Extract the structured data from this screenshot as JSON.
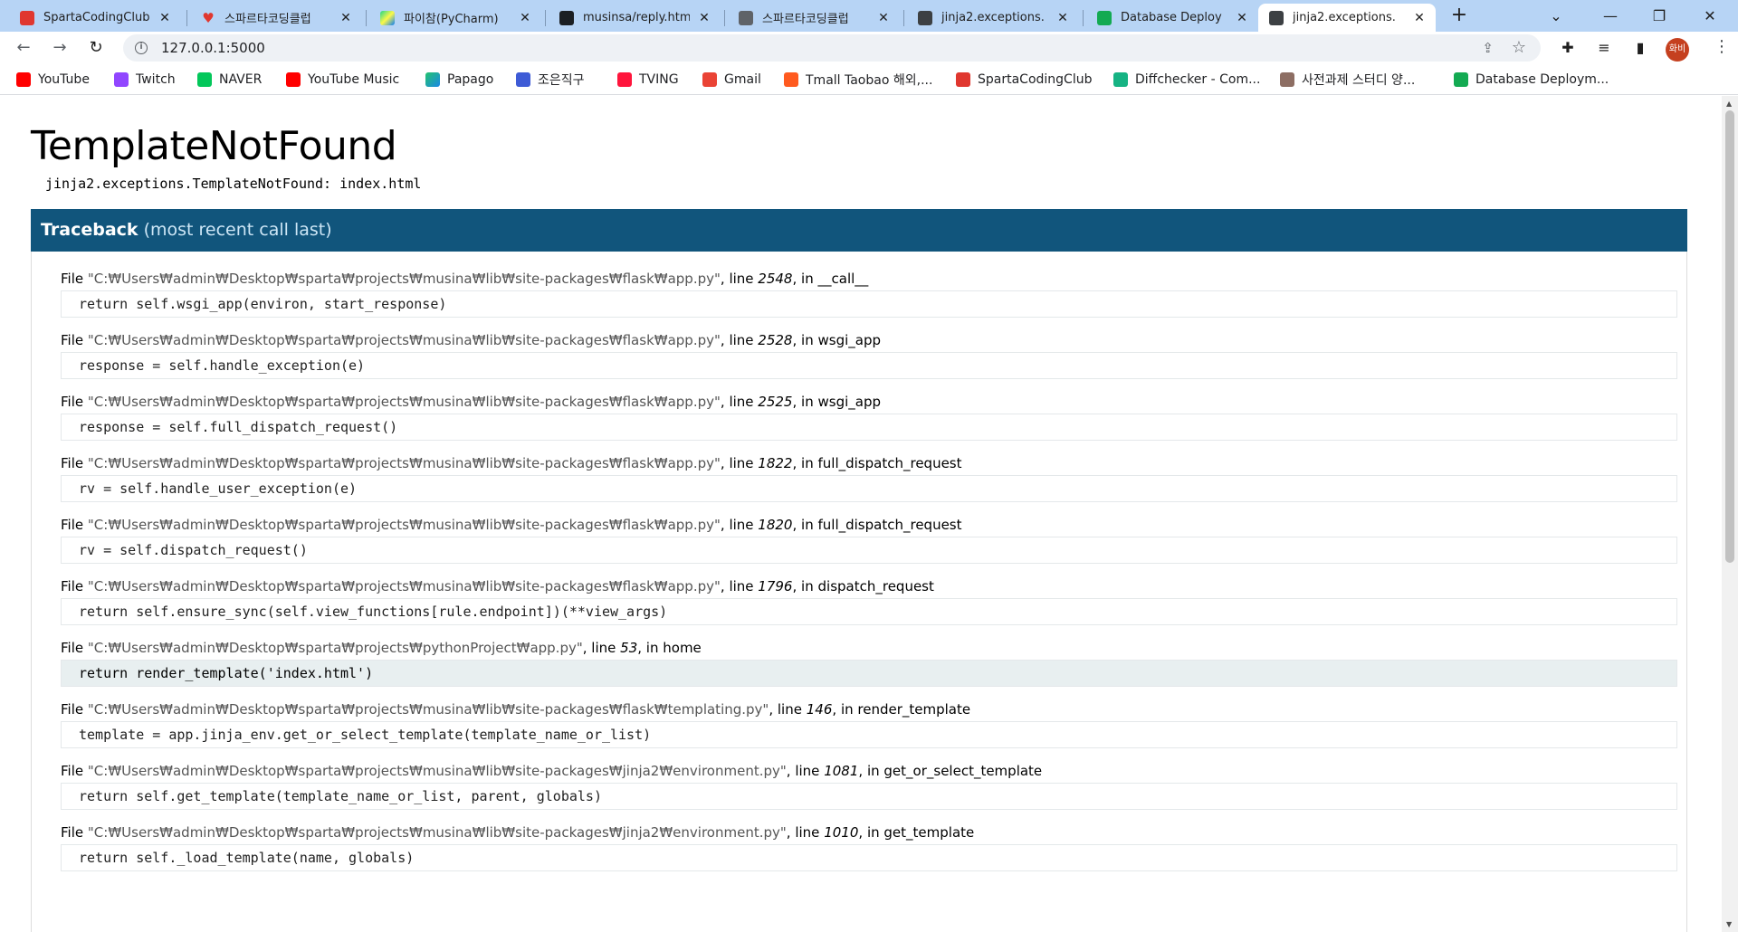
{
  "tabs": [
    {
      "title": "SpartaCodingClub",
      "icon": "sparta-icon"
    },
    {
      "title": "스파르타코딩클럽",
      "icon": "heart-icon"
    },
    {
      "title": "파이참(PyCharm)",
      "icon": "pycharm-icon"
    },
    {
      "title": "musinsa/reply.htm",
      "icon": "github-icon"
    },
    {
      "title": "스파르타코딩클럽",
      "icon": "globe-icon"
    },
    {
      "title": "jinja2.exceptions.",
      "icon": "terminal-icon"
    },
    {
      "title": "Database Deploy",
      "icon": "mongodb-icon"
    },
    {
      "title": "jinja2.exceptions.",
      "icon": "terminal-icon"
    }
  ],
  "address_bar": {
    "url": "127.0.0.1:5000"
  },
  "profile": {
    "label": "화비"
  },
  "bookmarks": [
    {
      "label": "YouTube"
    },
    {
      "label": "Twitch"
    },
    {
      "label": "NAVER"
    },
    {
      "label": "YouTube Music"
    },
    {
      "label": "Papago"
    },
    {
      "label": "조은직구"
    },
    {
      "label": "TVING"
    },
    {
      "label": "Gmail"
    },
    {
      "label": "Tmall Taobao 해외,..."
    },
    {
      "label": "SpartaCodingClub"
    },
    {
      "label": "Diffchecker - Com..."
    },
    {
      "label": "사전과제 스터디 양..."
    },
    {
      "label": "Database Deploym..."
    }
  ],
  "error": {
    "title": "TemplateNotFound",
    "message": "jinja2.exceptions.TemplateNotFound: index.html"
  },
  "traceback": {
    "heading": "Traceback",
    "subheading": "(most recent call last)",
    "frames": [
      {
        "file": "\"C:₩Users₩admin₩Desktop₩sparta₩projects₩musina₩lib₩site-packages₩flask₩app.py\"",
        "line": "2548",
        "func": "__call__",
        "code": "return self.wsgi_app(environ, start_response)"
      },
      {
        "file": "\"C:₩Users₩admin₩Desktop₩sparta₩projects₩musina₩lib₩site-packages₩flask₩app.py\"",
        "line": "2528",
        "func": "wsgi_app",
        "code": "response = self.handle_exception(e)"
      },
      {
        "file": "\"C:₩Users₩admin₩Desktop₩sparta₩projects₩musina₩lib₩site-packages₩flask₩app.py\"",
        "line": "2525",
        "func": "wsgi_app",
        "code": "response = self.full_dispatch_request()"
      },
      {
        "file": "\"C:₩Users₩admin₩Desktop₩sparta₩projects₩musina₩lib₩site-packages₩flask₩app.py\"",
        "line": "1822",
        "func": "full_dispatch_request",
        "code": "rv = self.handle_user_exception(e)"
      },
      {
        "file": "\"C:₩Users₩admin₩Desktop₩sparta₩projects₩musina₩lib₩site-packages₩flask₩app.py\"",
        "line": "1820",
        "func": "full_dispatch_request",
        "code": "rv = self.dispatch_request()"
      },
      {
        "file": "\"C:₩Users₩admin₩Desktop₩sparta₩projects₩musina₩lib₩site-packages₩flask₩app.py\"",
        "line": "1796",
        "func": "dispatch_request",
        "code": "return self.ensure_sync(self.view_functions[rule.endpoint])(**view_args)"
      },
      {
        "file": "\"C:₩Users₩admin₩Desktop₩sparta₩projects₩pythonProject₩app.py\"",
        "line": "53",
        "func": "home",
        "code": "return render_template('index.html')"
      },
      {
        "file": "\"C:₩Users₩admin₩Desktop₩sparta₩projects₩musina₩lib₩site-packages₩flask₩templating.py\"",
        "line": "146",
        "func": "render_template",
        "code": "template = app.jinja_env.get_or_select_template(template_name_or_list)"
      },
      {
        "file": "\"C:₩Users₩admin₩Desktop₩sparta₩projects₩musina₩lib₩site-packages₩jinja2₩environment.py\"",
        "line": "1081",
        "func": "get_or_select_template",
        "code": "return self.get_template(template_name_or_list, parent, globals)"
      },
      {
        "file": "\"C:₩Users₩admin₩Desktop₩sparta₩projects₩musina₩lib₩site-packages₩jinja2₩environment.py\"",
        "line": "1010",
        "func": "get_template",
        "code": "return self._load_template(name, globals)"
      }
    ],
    "labels": {
      "file": "File",
      "line": "line",
      "in": "in"
    }
  },
  "colors": {
    "tabstrip": "#b7d4f5",
    "traceback_header": "#11557c",
    "current_frame_bg": "#e8eff0"
  }
}
